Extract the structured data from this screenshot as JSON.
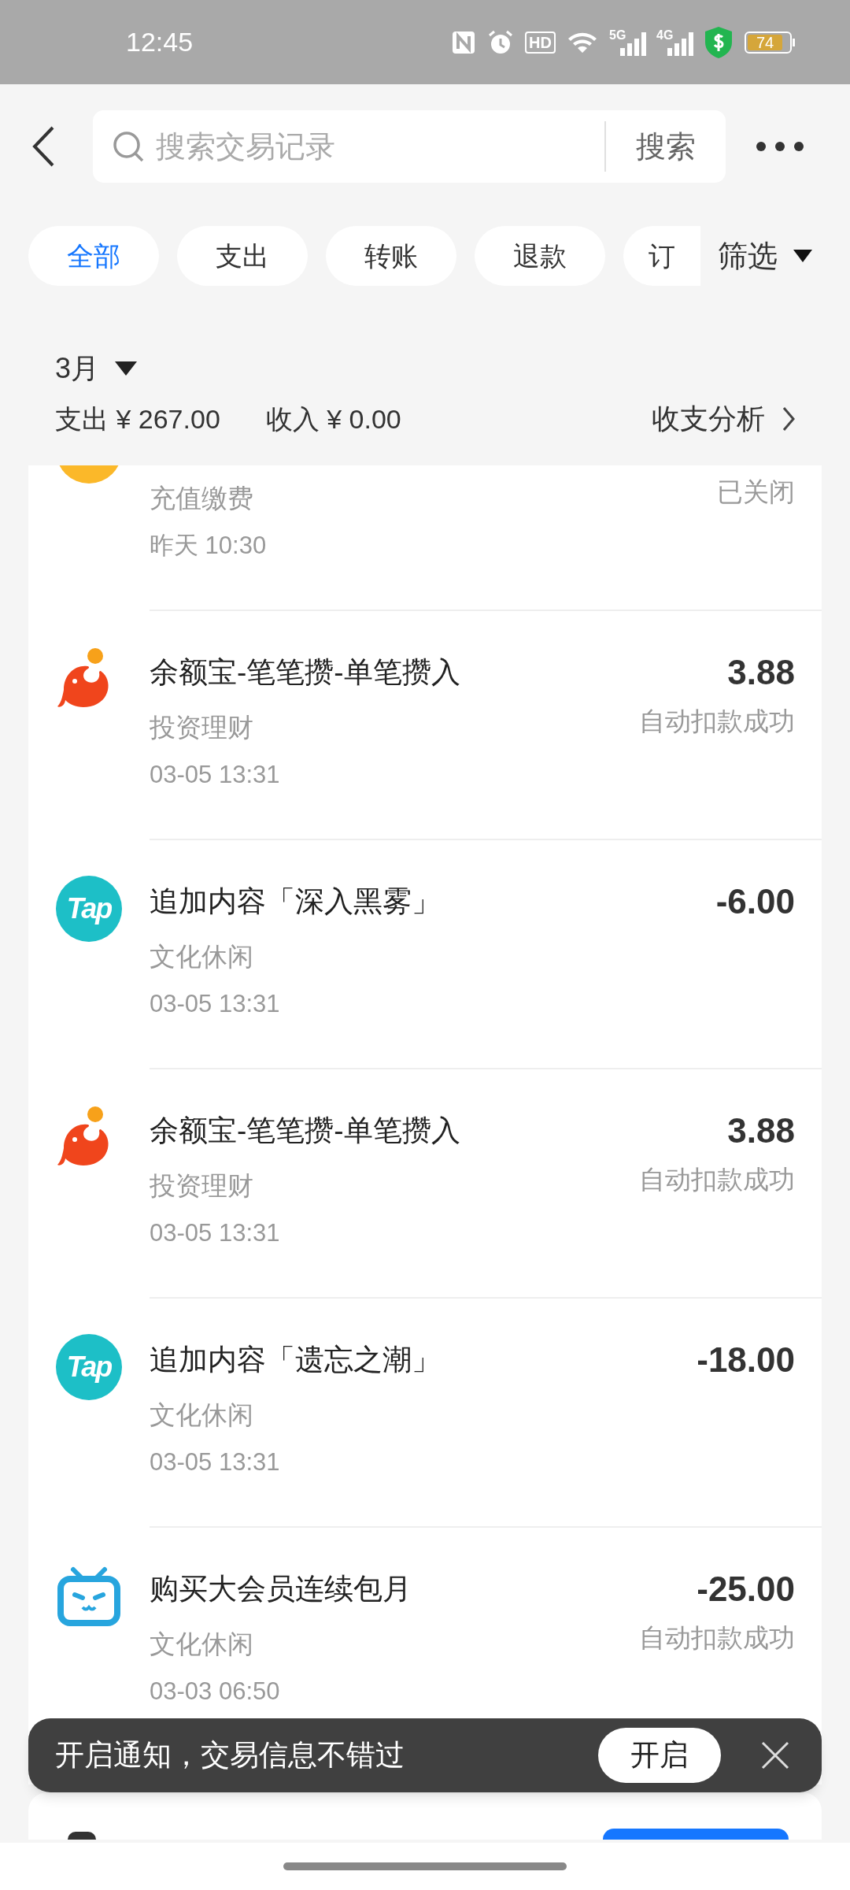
{
  "status_bar": {
    "time": "12:45",
    "hd": "HD",
    "networks": [
      "5G",
      "4G"
    ],
    "battery": "74"
  },
  "search": {
    "placeholder": "搜索交易记录",
    "button": "搜索"
  },
  "filters": [
    {
      "label": "全部",
      "selected": true
    },
    {
      "label": "支出",
      "selected": false
    },
    {
      "label": "转账",
      "selected": false
    },
    {
      "label": "退款",
      "selected": false
    },
    {
      "label": "订",
      "selected": false
    }
  ],
  "filter_button": "筛选",
  "month": "3月",
  "summary": {
    "expense": "支出 ¥ 267.00",
    "income": "收入 ¥ 0.00",
    "analysis": "收支分析"
  },
  "transactions": [
    {
      "kind": "topup",
      "subtitle": "充值缴费",
      "status": "已关闭",
      "time": "昨天 10:30"
    },
    {
      "kind": "fund",
      "title": "余额宝-笔笔攒-单笔攒入",
      "amount": "3.88",
      "subtitle": "投资理财",
      "status": "自动扣款成功",
      "time": "03-05 13:31"
    },
    {
      "kind": "tap",
      "icon_text": "Tap",
      "title": "追加内容「深入黑雾」",
      "amount": "-6.00",
      "subtitle": "文化休闲",
      "time": "03-05 13:31"
    },
    {
      "kind": "fund",
      "title": "余额宝-笔笔攒-单笔攒入",
      "amount": "3.88",
      "subtitle": "投资理财",
      "status": "自动扣款成功",
      "time": "03-05 13:31"
    },
    {
      "kind": "tap",
      "icon_text": "Tap",
      "title": "追加内容「遗忘之潮」",
      "amount": "-18.00",
      "subtitle": "文化休闲",
      "time": "03-05 13:31"
    },
    {
      "kind": "tv",
      "title": "购买大会员连续包月",
      "amount": "-25.00",
      "subtitle": "文化休闲",
      "status": "自动扣款成功",
      "time": "03-03 06:50"
    }
  ],
  "toast": {
    "text": "开启通知，交易信息不错过",
    "button": "开启"
  }
}
